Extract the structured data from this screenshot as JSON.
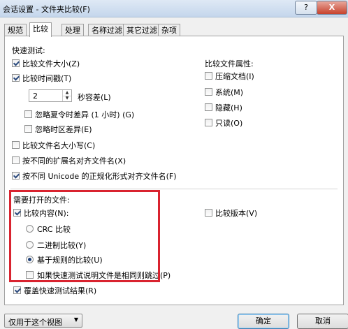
{
  "window": {
    "title": "会话设置 - 文件夹比较(F)",
    "help_label": "?",
    "close_label": "X"
  },
  "tabs": [
    "规范",
    "比较",
    "处理",
    "名称过滤",
    "其它过滤",
    "杂项"
  ],
  "active_tab": "比较",
  "quick_test": {
    "header": "快速测试:",
    "compare_size": "比较文件大小(Z)",
    "compare_time": "比较时间戳(T)",
    "tolerance_value": "2",
    "tolerance_label": "秒容差(L)",
    "ignore_dst": "忽略夏令时差异 (1 小时) (G)",
    "ignore_timezone": "忽略时区差异(E)",
    "compare_case": "比较文件名大小写(C)",
    "align_ext": "按不同的扩展名对齐文件名(X)",
    "align_unicode": "按不同 Unicode 的正规化形式对齐文件名(F)"
  },
  "attributes": {
    "header": "比较文件属性:",
    "compressed": "压缩文档(I)",
    "system": "系统(M)",
    "hidden": "隐藏(H)",
    "readonly": "只读(O)"
  },
  "open_files": {
    "header": "需要打开的文件:",
    "compare_content": "比较内容(N):",
    "crc": "CRC 比较",
    "binary": "二进制比较(Y)",
    "rules": "基于规则的比较(U)",
    "skip_if_same": "如果快速测试说明文件是相同则跳过(P)",
    "compare_version": "比较版本(V)",
    "override": "覆盖快速测试结果(R)"
  },
  "footer": {
    "scope": "仅用于这个视图",
    "ok": "确定",
    "cancel": "取消"
  }
}
